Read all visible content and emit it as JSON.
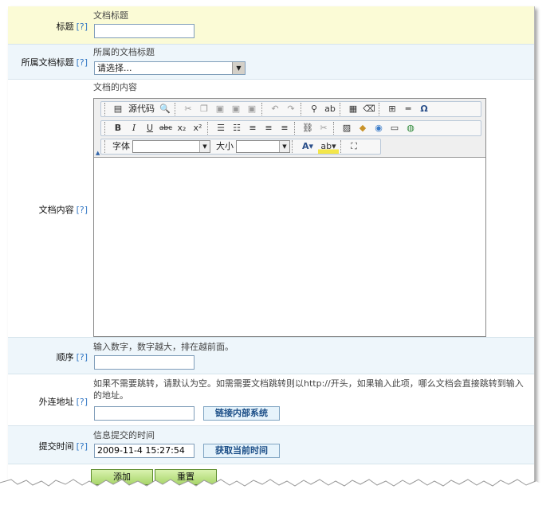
{
  "help_marker": "[?]",
  "title_row": {
    "label": "标题",
    "hint": "文档标题",
    "value": ""
  },
  "document_row": {
    "label": "所属文档标题",
    "hint": "所属的文档标题",
    "selected": "请选择..."
  },
  "content_row": {
    "label": "文档内容",
    "hint": "文档的内容",
    "editor": {
      "source_label": "源代码",
      "font_label": "字体",
      "size_label": "大小",
      "font_value": "",
      "size_value": ""
    }
  },
  "order_row": {
    "label": "顺序",
    "hint": "输入数字，数字越大，排在越前面。",
    "value": ""
  },
  "link_row": {
    "label": "外连地址",
    "hint": "如果不需要跳转，请默认为空。如需需要文档跳转则以http://开头，如果输入此项，哪么文档会直接跳转到输入的地址。",
    "value": "",
    "button": "链接内部系统"
  },
  "time_row": {
    "label": "提交时间",
    "hint": "信息提交的时间",
    "value": "2009-11-4 15:27:54",
    "button": "获取当前时间"
  },
  "actions": {
    "add": "添加",
    "reset": "重置"
  },
  "colors": {
    "title_row_bg": "#fbfbd6",
    "alt_row_bg": "#eef6fb",
    "help_link": "#3478c4",
    "action_button": "#a8d66a"
  }
}
